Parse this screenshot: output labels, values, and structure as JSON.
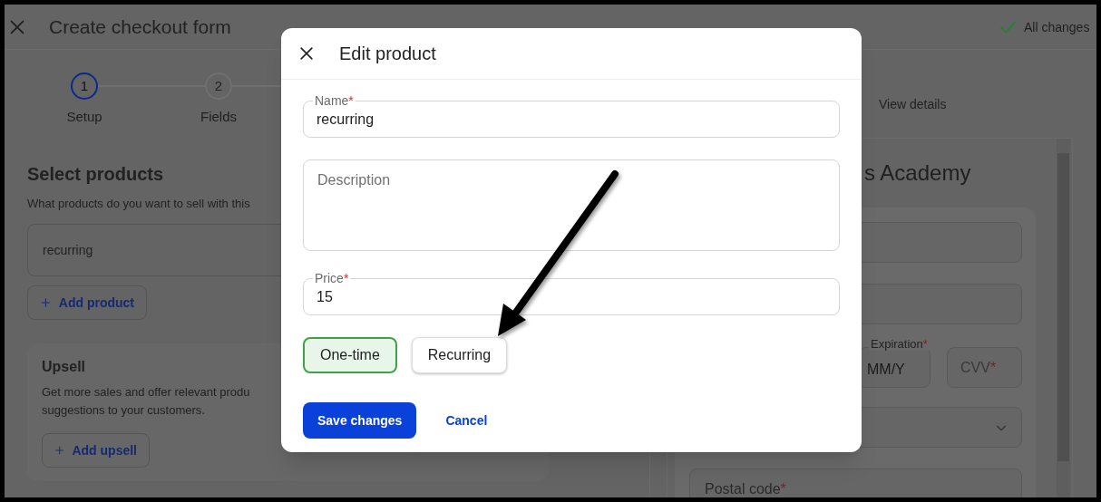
{
  "page": {
    "title": "Create checkout form",
    "save_status": "All changes"
  },
  "steps": [
    {
      "number": "1",
      "label": "Setup",
      "selected": true
    },
    {
      "number": "2",
      "label": "Fields",
      "selected": false
    }
  ],
  "products": {
    "title": "Select products",
    "subtitle": "What products do you want to sell with this",
    "items": [
      "recurring"
    ],
    "add_button": "Add product"
  },
  "upsell": {
    "title": "Upsell",
    "text": "Get more sales and offer relevant produ",
    "text_line_2": "suggestions to your customers.",
    "add_button": "Add upsell"
  },
  "preview": {
    "tab": "View details",
    "heading": "s Academy",
    "expiration": {
      "label": "Expiration",
      "required_mark": "*",
      "placeholder": "MM/Y"
    },
    "cvv": {
      "placeholder": "CVV",
      "required_mark": "*"
    },
    "postal_code": {
      "placeholder": "Postal code",
      "required_mark": "*"
    }
  },
  "modal": {
    "title": "Edit product",
    "name": {
      "label": "Name",
      "required_mark": "*",
      "value": "recurring"
    },
    "description": {
      "placeholder": "Description"
    },
    "price": {
      "label": "Price",
      "required_mark": "*",
      "value": "15"
    },
    "pricing_options": [
      {
        "label": "One-time",
        "selected": true
      },
      {
        "label": "Recurring",
        "selected": false
      }
    ],
    "save_button": "Save changes",
    "cancel_button": "Cancel"
  }
}
